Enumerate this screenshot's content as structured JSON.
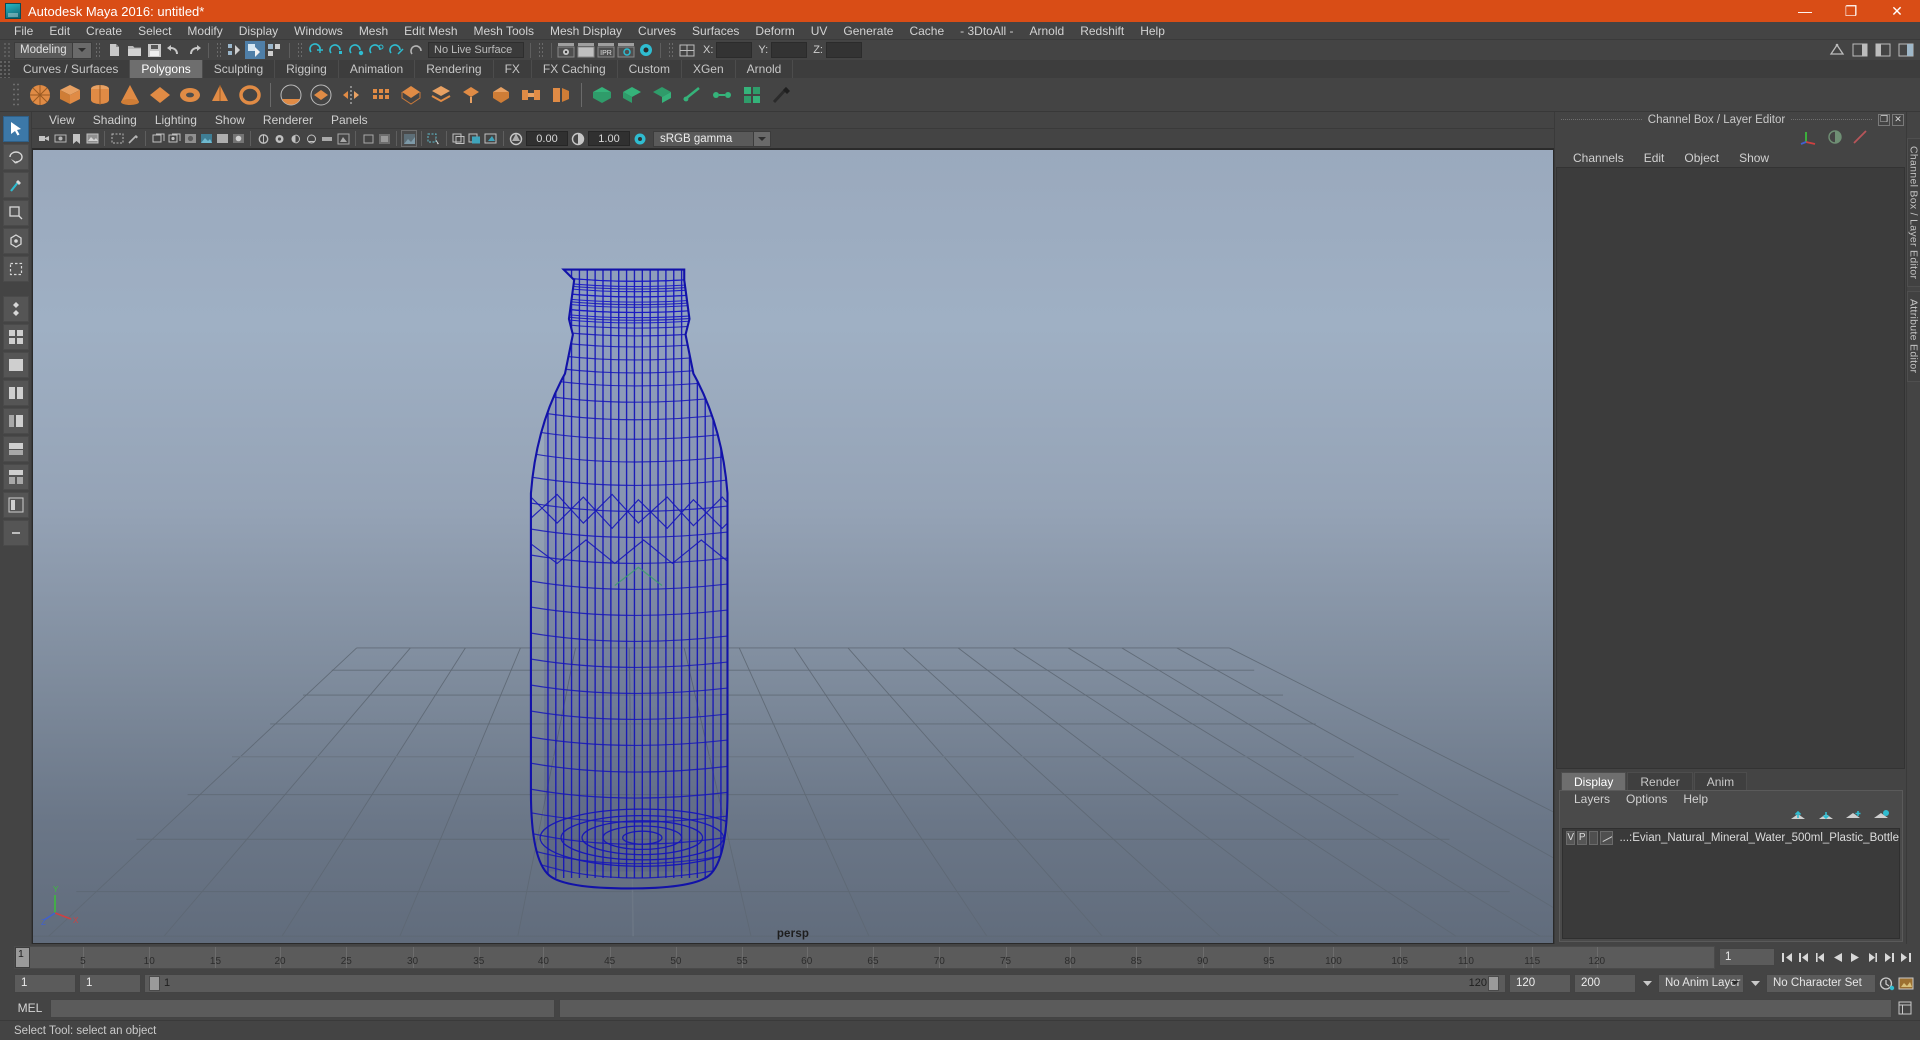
{
  "titlebar": {
    "text": "Autodesk Maya 2016: untitled*",
    "minimize": "—",
    "maximize": "❐",
    "close": "✕"
  },
  "menubar": {
    "items": [
      {
        "label": "File"
      },
      {
        "label": "Edit"
      },
      {
        "label": "Create"
      },
      {
        "label": "Select"
      },
      {
        "label": "Modify"
      },
      {
        "label": "Display"
      },
      {
        "label": "Windows"
      },
      {
        "label": "Mesh"
      },
      {
        "label": "Edit Mesh"
      },
      {
        "label": "Mesh Tools"
      },
      {
        "label": "Mesh Display"
      },
      {
        "label": "Curves"
      },
      {
        "label": "Surfaces"
      },
      {
        "label": "Deform"
      },
      {
        "label": "UV"
      },
      {
        "label": "Generate"
      },
      {
        "label": "Cache"
      },
      {
        "label": "- 3DtoAll -"
      },
      {
        "label": "Arnold"
      },
      {
        "label": "Redshift"
      },
      {
        "label": "Help"
      }
    ]
  },
  "statusline": {
    "menuset": "Modeling",
    "live_surface": "No Live Surface",
    "coord_x_label": "X:",
    "coord_y_label": "Y:",
    "coord_z_label": "Z:"
  },
  "shelf": {
    "tabs": [
      {
        "label": "Curves / Surfaces",
        "active": false
      },
      {
        "label": "Polygons",
        "active": true
      },
      {
        "label": "Sculpting",
        "active": false
      },
      {
        "label": "Rigging",
        "active": false
      },
      {
        "label": "Animation",
        "active": false
      },
      {
        "label": "Rendering",
        "active": false
      },
      {
        "label": "FX",
        "active": false
      },
      {
        "label": "FX Caching",
        "active": false
      },
      {
        "label": "Custom",
        "active": false
      },
      {
        "label": "XGen",
        "active": false
      },
      {
        "label": "Arnold",
        "active": false
      }
    ]
  },
  "viewport": {
    "panel_menus": [
      "View",
      "Shading",
      "Lighting",
      "Show",
      "Renderer",
      "Panels"
    ],
    "exposure_value": "0.00",
    "gamma_value": "1.00",
    "color_management": "sRGB gamma",
    "camera_label": "persp",
    "axis_labels": {
      "y": "Y",
      "x": "X",
      "z": "Z"
    }
  },
  "right_panel": {
    "title": "Channel Box / Layer Editor",
    "undock_glyph": "❐",
    "close_glyph": "✕",
    "channel_menus": [
      "Channels",
      "Edit",
      "Object",
      "Show"
    ],
    "layer_tabs": [
      {
        "label": "Display",
        "active": true
      },
      {
        "label": "Render",
        "active": false
      },
      {
        "label": "Anim",
        "active": false
      }
    ],
    "layer_menus": [
      "Layers",
      "Options",
      "Help"
    ],
    "layers": [
      {
        "visibility": "V",
        "playback": "P",
        "name": "...:Evian_Natural_Mineral_Water_500ml_Plastic_Bottle"
      }
    ],
    "vertical_tabs": [
      "Channel Box / Layer Editor",
      "Attribute Editor"
    ]
  },
  "timeline": {
    "ticks": [
      {
        "frame": "5"
      },
      {
        "frame": "10"
      },
      {
        "frame": "15"
      },
      {
        "frame": "20"
      },
      {
        "frame": "25"
      },
      {
        "frame": "30"
      },
      {
        "frame": "35"
      },
      {
        "frame": "40"
      },
      {
        "frame": "45"
      },
      {
        "frame": "50"
      },
      {
        "frame": "55"
      },
      {
        "frame": "60"
      },
      {
        "frame": "65"
      },
      {
        "frame": "70"
      },
      {
        "frame": "75"
      },
      {
        "frame": "80"
      },
      {
        "frame": "85"
      },
      {
        "frame": "90"
      },
      {
        "frame": "95"
      },
      {
        "frame": "100"
      },
      {
        "frame": "105"
      },
      {
        "frame": "110"
      },
      {
        "frame": "115"
      },
      {
        "frame": "120"
      }
    ],
    "current_frame": "1",
    "current_frame_field": "1",
    "range_start": "1",
    "range_start_inner": "1",
    "slider_left_label": "1",
    "slider_right_label": "120",
    "range_end_inner": "120",
    "range_end": "200",
    "anim_layer": "No Anim Layer",
    "character_set": "No Character Set"
  },
  "command_line": {
    "label": "MEL",
    "input_value": "",
    "output_value": ""
  },
  "statusbar": {
    "text": "Select Tool: select an object"
  },
  "colors": {
    "brand_orange": "#d94d16",
    "accent_blue": "#4f7fa8",
    "shelf_orange": "#e08b45",
    "wireframe_blue": "#1414b4",
    "teal": "#29b4c4"
  }
}
